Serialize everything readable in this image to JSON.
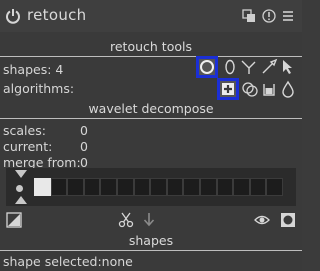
{
  "module": {
    "title": "retouch",
    "header_icons": [
      "presets-icon",
      "reset-icon",
      "menu-icon"
    ]
  },
  "retouch_tools": {
    "section_title": "retouch tools",
    "shapes_label": "shapes: 4",
    "algorithms_label": "algorithms:",
    "shape_tools": [
      "circle-icon",
      "ellipse-icon",
      "path-icon",
      "brush-icon",
      "show-shapes-icon"
    ],
    "algorithm_tools": [
      "heal-icon",
      "clone-icon",
      "fill-icon",
      "blur-icon"
    ],
    "selected_shape_tool": "circle-icon",
    "selected_algorithm": "heal-icon"
  },
  "wavelet": {
    "section_title": "wavelet decompose",
    "scales_label": "scales:",
    "scales_value": "0",
    "current_label": "current:",
    "current_value": "0",
    "merge_label": "merge from:",
    "merge_value": "0",
    "cells_count": 15,
    "active_cell": 0,
    "bottom_icons": [
      "display-wavelet-icon",
      "cut-icon",
      "paste-down-icon",
      "visibility-icon",
      "mask-square-icon"
    ]
  },
  "shapes_section": {
    "section_title": "shapes",
    "selected_label": "shape selected:",
    "selected_value": "none"
  },
  "colors": {
    "selection_outline": "#1b2fd6",
    "background": "#3b3b3b"
  }
}
